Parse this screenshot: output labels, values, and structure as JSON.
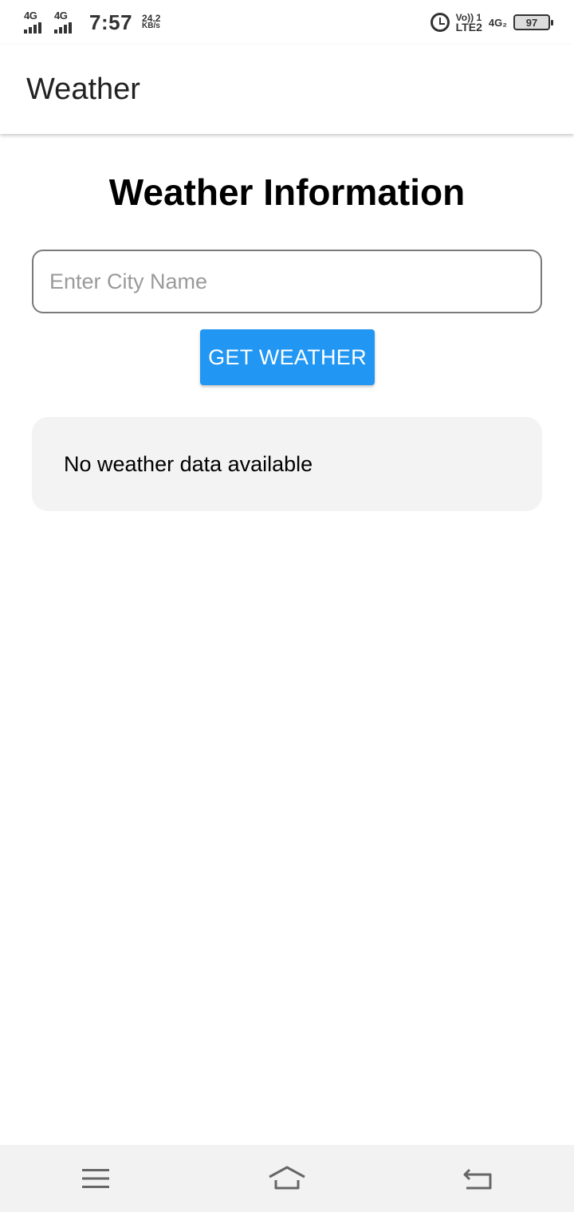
{
  "status_bar": {
    "sim1_network": "4G",
    "sim2_network": "4G",
    "time": "7:57",
    "speed_value": "24.2",
    "speed_unit": "KB/s",
    "volte_top": "Vo)) 1",
    "volte_bottom": "LTE2",
    "network_right": "4G₂",
    "battery_level": "97",
    "icons": [
      "signal-icon",
      "alarm-icon",
      "battery-icon"
    ]
  },
  "app_bar": {
    "title": "Weather"
  },
  "main": {
    "heading": "Weather Information",
    "city_input": {
      "value": "",
      "placeholder": "Enter City Name"
    },
    "get_weather_label": "GET WEATHER",
    "result_message": "No weather data available"
  },
  "nav_bar": {
    "icons": [
      "menu-icon",
      "home-icon",
      "back-icon"
    ]
  },
  "colors": {
    "accent": "#2196f3",
    "card_bg": "#f3f3f3",
    "nav_bg": "#f2f2f2"
  }
}
